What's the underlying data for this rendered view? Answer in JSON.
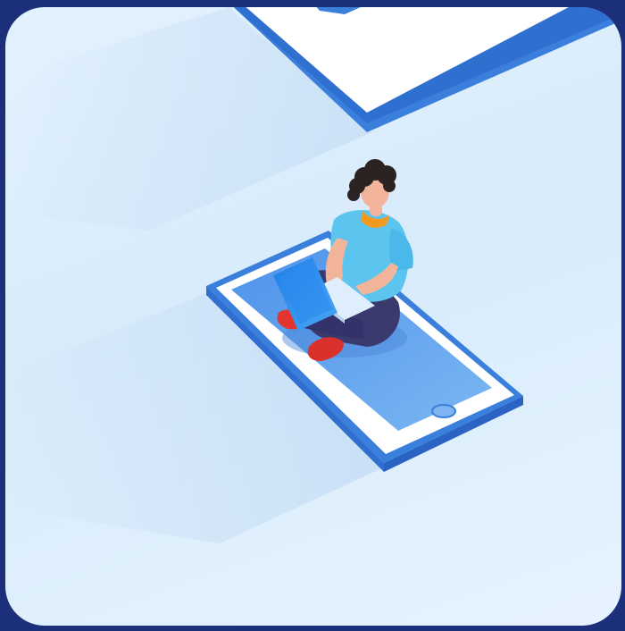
{
  "illustration": {
    "subject": "isometric-person-with-laptop-sitting-on-smartphone",
    "icons": [
      "phone-icon",
      "person-icon",
      "laptop-icon"
    ]
  },
  "colors": {
    "page_background": "#1b2f7a",
    "card_background": "#e3f1fd",
    "phone_frame": "#3a7fdc",
    "phone_bezel": "#ffffff",
    "phone_screen": "#6aa9ee",
    "shirt": "#5cc5ef",
    "pants": "#3b3a6e",
    "hair": "#2a2321",
    "skin": "#f2b49a",
    "shoes": "#e3342f",
    "laptop": "#2f8ff0",
    "collar": "#f29a1f"
  }
}
